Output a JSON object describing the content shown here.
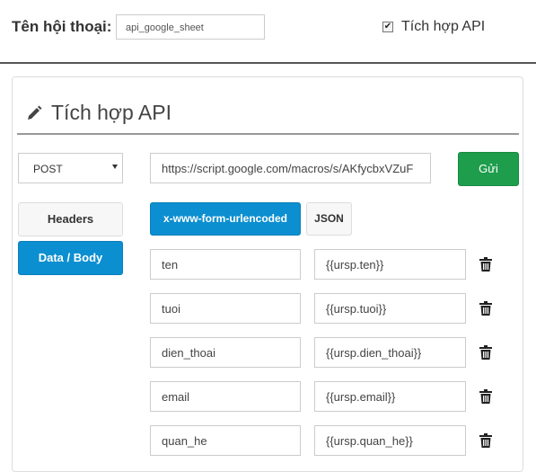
{
  "header": {
    "dialog_label": "Tên hội thoại:",
    "dialog_name": "api_google_sheet",
    "api_checkbox_checked": true,
    "api_checkbox_label": "Tích hợp API"
  },
  "panel": {
    "title": "Tích hợp API",
    "method": "POST",
    "url": "https://script.google.com/macros/s/AKfycbxVZuF",
    "send_label": "Gửi"
  },
  "sidebar": {
    "items": [
      {
        "label": "Headers",
        "active": false
      },
      {
        "label": "Data / Body",
        "active": true
      }
    ]
  },
  "encoding": {
    "options": [
      {
        "label": "x-www-form-urlencoded",
        "active": true
      },
      {
        "label": "JSON",
        "active": false
      }
    ]
  },
  "body_params": [
    {
      "key": "ten",
      "value": "{{ursp.ten}}"
    },
    {
      "key": "tuoi",
      "value": "{{ursp.tuoi}}"
    },
    {
      "key": "dien_thoai",
      "value": "{{ursp.dien_thoai}}"
    },
    {
      "key": "email",
      "value": "{{ursp.email}}"
    },
    {
      "key": "quan_he",
      "value": "{{ursp.quan_he}}"
    }
  ],
  "icons": {
    "edit": "pencil-icon",
    "delete": "trash-icon",
    "checkbox": "checkmark-icon",
    "dropdown": "chevron-down-icon"
  },
  "colors": {
    "primary": "#0c8fd0",
    "success": "#1e9d4d"
  }
}
